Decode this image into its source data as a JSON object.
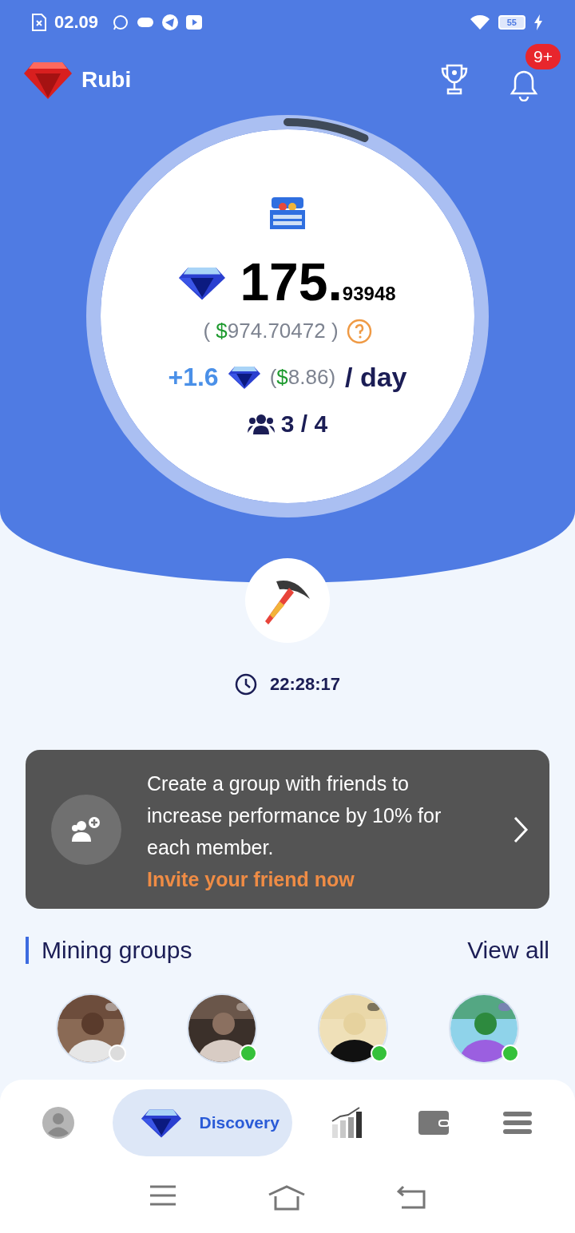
{
  "status_bar": {
    "time": "02.09",
    "battery": "55"
  },
  "app_bar": {
    "title": "Rubi",
    "notification_badge": "9+"
  },
  "balance": {
    "integer": "175.",
    "decimals": "93948",
    "mining_progress": {
      "level": 0.065
    }
  },
  "usd_value": {
    "prefix": "( ",
    "currency": "$",
    "amount": "974.70472",
    "suffix": " )"
  },
  "rate": {
    "amount": "+1.6",
    "usd_prefix": "(",
    "currency": "$",
    "usd_amount": "8.86",
    "usd_suffix": ")",
    "unit": "/ day"
  },
  "members": "3 / 4",
  "timer": "22:28:17",
  "invite_card": {
    "text": "Create a group with friends to increase performance by 10% for each member.",
    "link": "Invite your friend now"
  },
  "mining_groups": {
    "title": "Mining groups",
    "view_all": "View all",
    "avatars": [
      {
        "kind": "picture",
        "online": false
      },
      {
        "kind": "picture",
        "online": true
      },
      {
        "kind": "picture",
        "online": true
      },
      {
        "kind": "picture",
        "online": true
      }
    ]
  },
  "bottom_nav": [
    {
      "kind": "profile",
      "selected": false
    },
    {
      "kind": "discovery",
      "label": "Discovery",
      "selected": true
    },
    {
      "kind": "chart",
      "selected": false
    },
    {
      "kind": "wallet",
      "selected": false
    },
    {
      "kind": "menu",
      "selected": false
    }
  ]
}
